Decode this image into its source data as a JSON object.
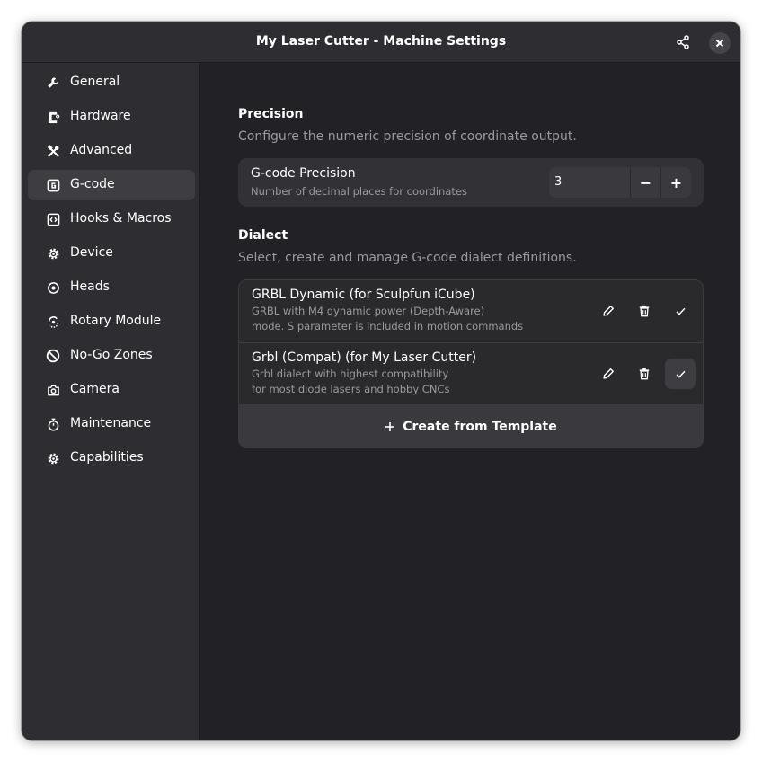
{
  "window": {
    "title": "My Laser Cutter - Machine Settings",
    "share_icon": "share-icon",
    "close_icon": "close-icon"
  },
  "sidebar": {
    "selected": "G-code",
    "items": [
      {
        "label": "General",
        "icon": "wrench-icon"
      },
      {
        "label": "Hardware",
        "icon": "hardware-icon"
      },
      {
        "label": "Advanced",
        "icon": "tools-icon"
      },
      {
        "label": "G-code",
        "icon": "gcode-icon"
      },
      {
        "label": "Hooks & Macros",
        "icon": "code-icon"
      },
      {
        "label": "Device",
        "icon": "gear-icon"
      },
      {
        "label": "Heads",
        "icon": "target-icon"
      },
      {
        "label": "Rotary Module",
        "icon": "rotary-icon"
      },
      {
        "label": "No-Go Zones",
        "icon": "prohibited-icon"
      },
      {
        "label": "Camera",
        "icon": "camera-icon"
      },
      {
        "label": "Maintenance",
        "icon": "stopwatch-icon"
      },
      {
        "label": "Capabilities",
        "icon": "gear-icon"
      }
    ]
  },
  "precision": {
    "heading": "Precision",
    "description": "Configure the numeric precision of coordinate output.",
    "row_title": "G-code Precision",
    "row_subtitle": "Number of decimal places for coordinates",
    "value": "3",
    "decrement": "−",
    "increment": "+"
  },
  "dialect": {
    "heading": "Dialect",
    "description": "Select, create and manage G-code dialect definitions.",
    "items": [
      {
        "title": "GRBL Dynamic (for Sculpfun iCube)",
        "line1": "GRBL with M4 dynamic power (Depth-Aware)",
        "line2": "mode. S parameter is included in motion commands",
        "selected": false
      },
      {
        "title": "Grbl (Compat) (for My Laser Cutter)",
        "line1": "Grbl dialect with highest compatibility",
        "line2": "for most diode lasers and hobby CNCs",
        "selected": true
      }
    ],
    "create_label": "Create from Template",
    "create_icon": "plus-icon"
  }
}
